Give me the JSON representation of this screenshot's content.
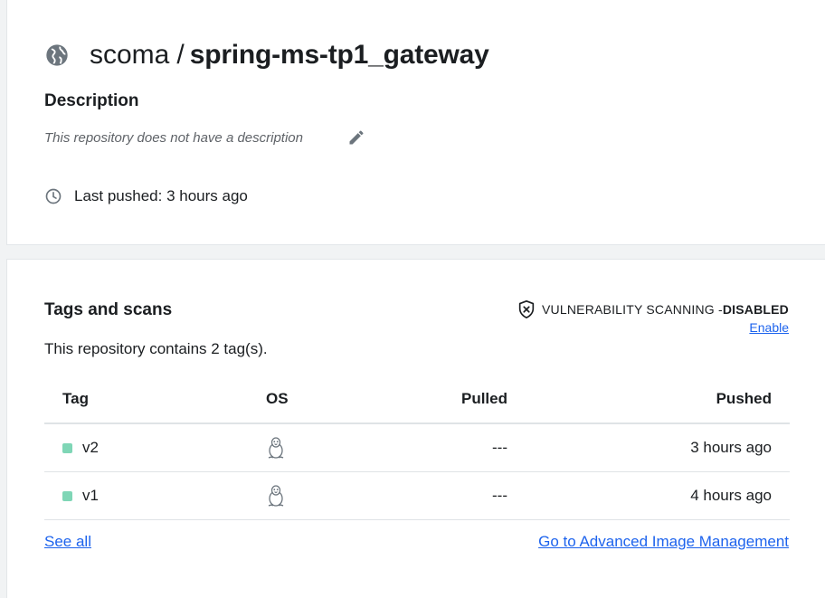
{
  "repo": {
    "namespace": "scoma",
    "separator": "/",
    "name": "spring-ms-tp1_gateway",
    "icon": "globe-icon"
  },
  "description": {
    "heading": "Description",
    "text": "This repository does not have a description",
    "edit_icon": "pencil-icon"
  },
  "last_pushed": {
    "text": "Last pushed: 3 hours ago",
    "icon": "clock-icon"
  },
  "tags_section": {
    "heading": "Tags and scans",
    "vulnerability_label": "VULNERABILITY SCANNING - ",
    "vulnerability_status": "DISABLED",
    "enable_label": "Enable",
    "tag_count_text": "This repository contains 2 tag(s).",
    "columns": [
      "Tag",
      "OS",
      "Pulled",
      "Pushed"
    ],
    "rows": [
      {
        "tag": "v2",
        "os": "linux",
        "pulled": "---",
        "pushed": "3 hours ago"
      },
      {
        "tag": "v1",
        "os": "linux",
        "pulled": "---",
        "pushed": "4 hours ago"
      }
    ],
    "see_all_label": "See all",
    "advanced_link_label": "Go to Advanced Image Management"
  },
  "colors": {
    "link": "#1d63ed",
    "tag_dot": "#7fd6b6",
    "icon_gray": "#6c757d"
  }
}
